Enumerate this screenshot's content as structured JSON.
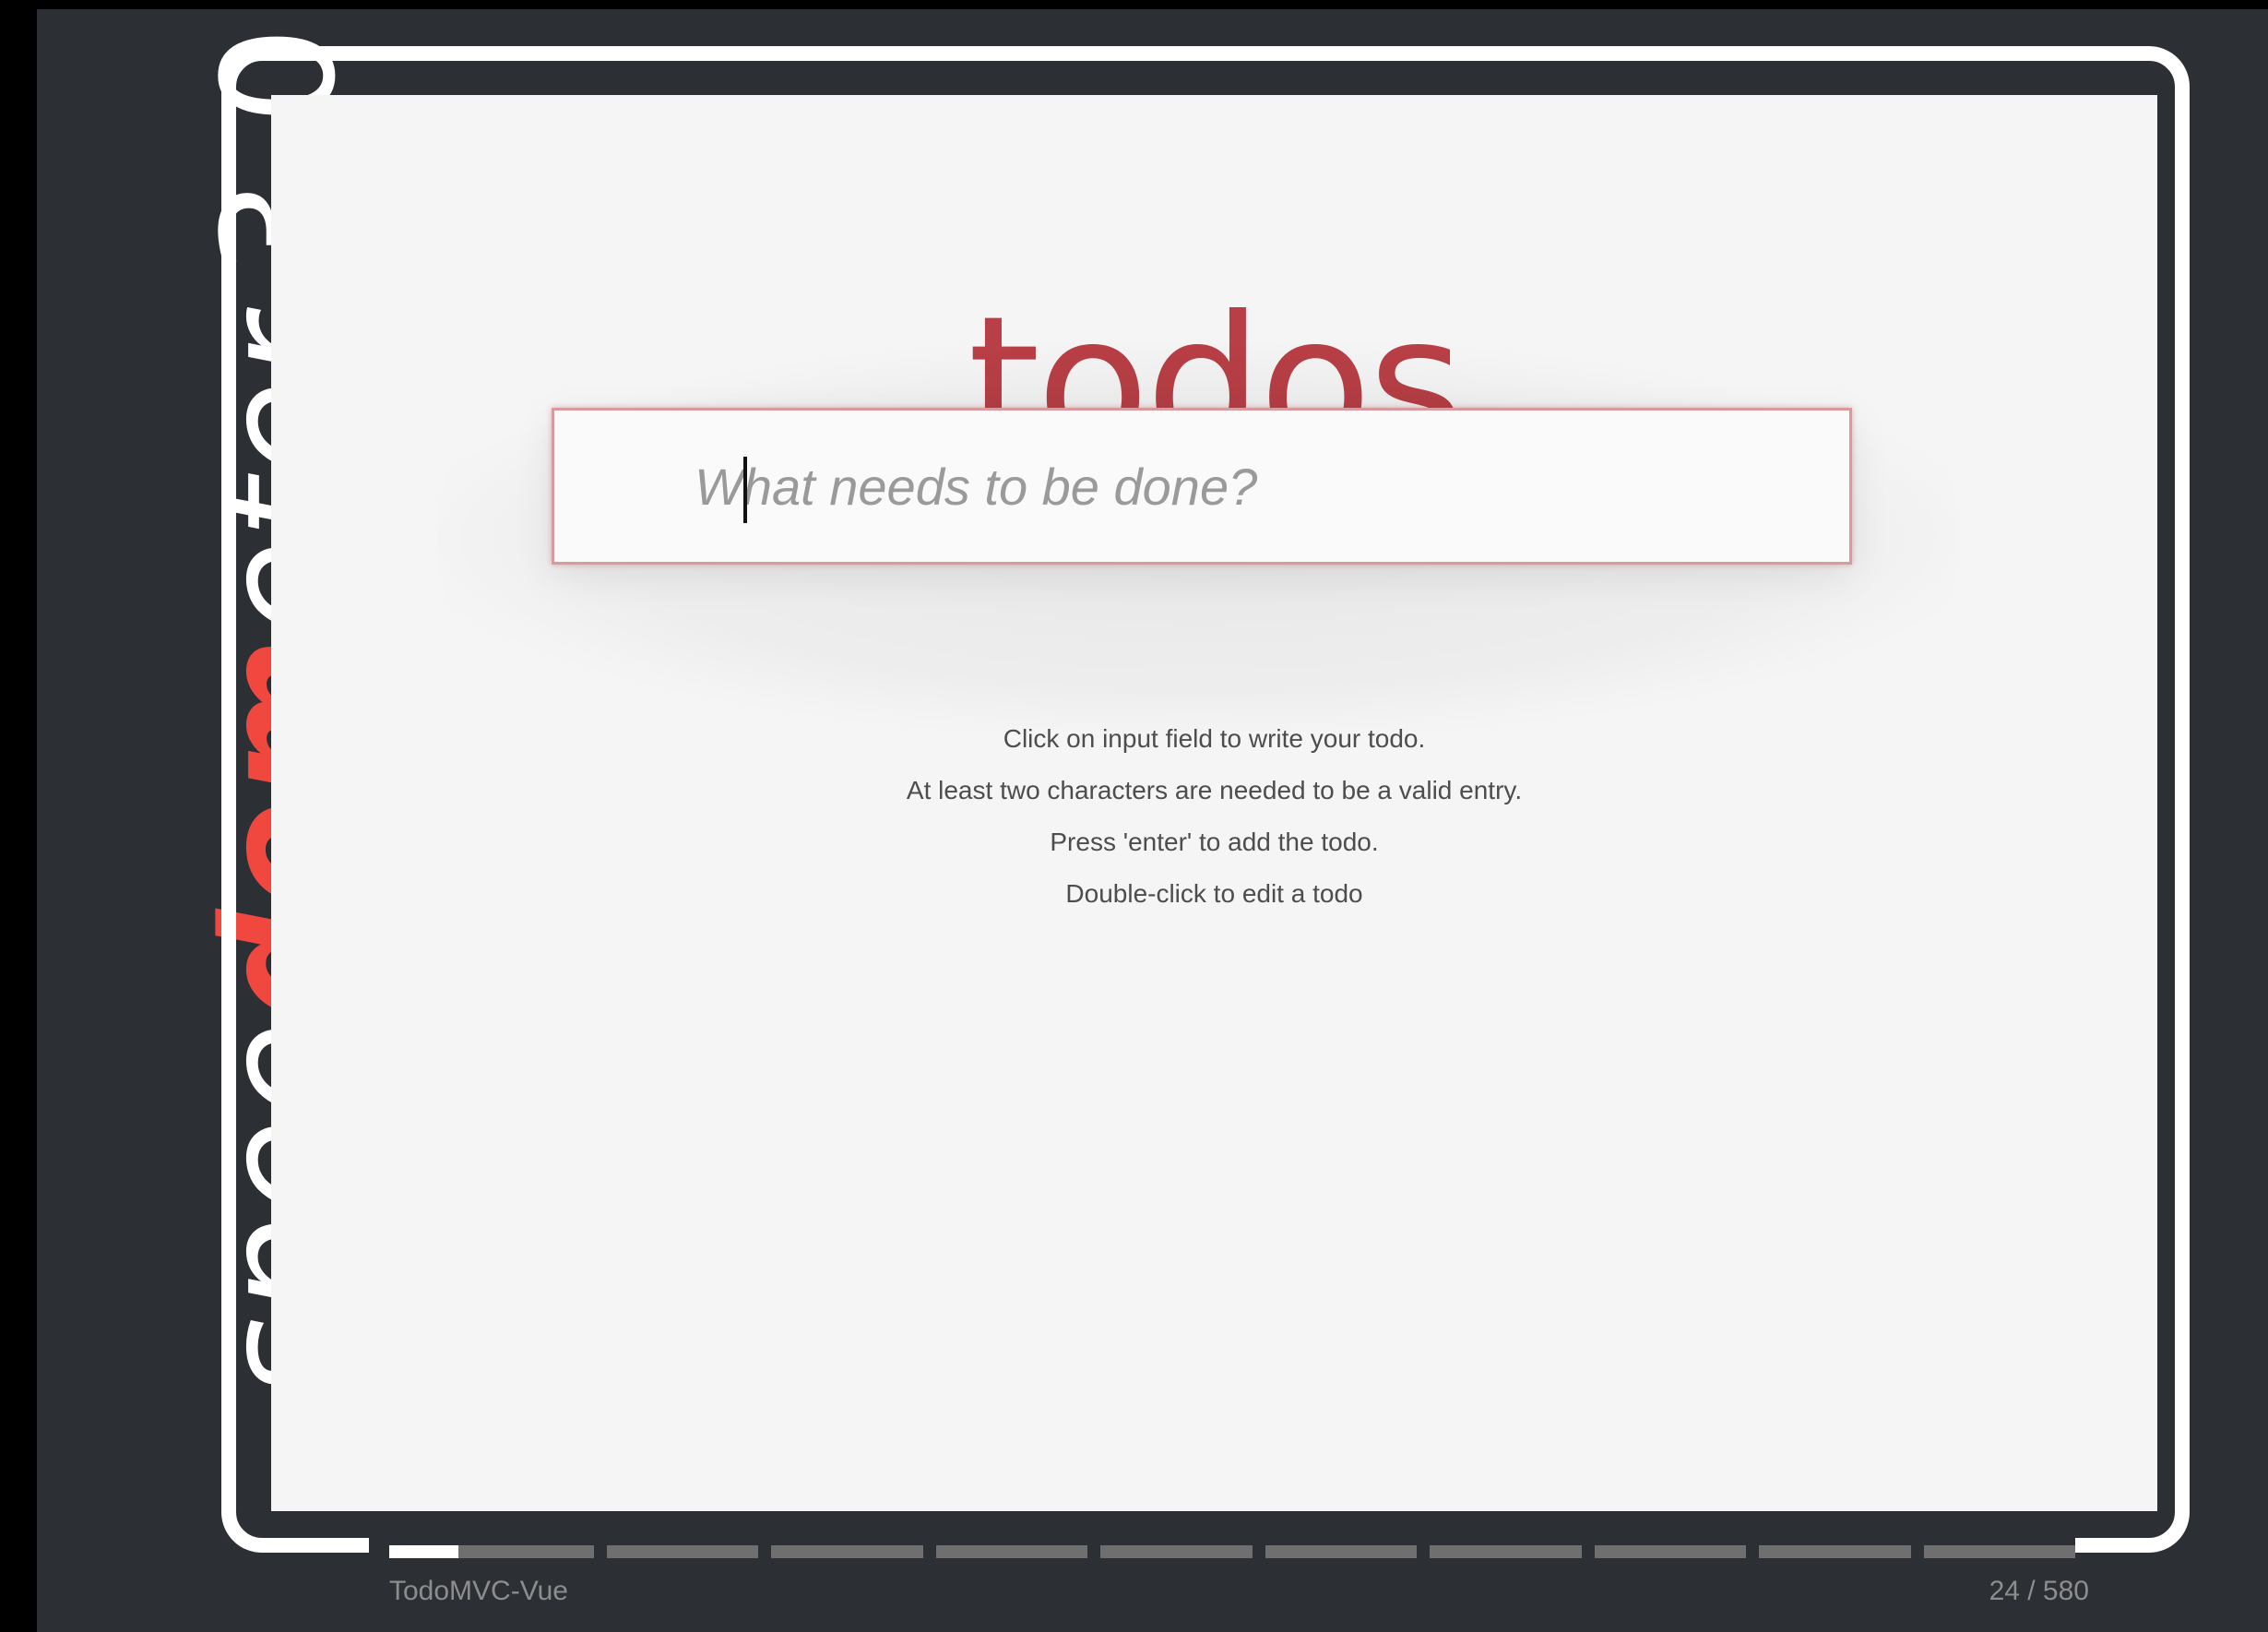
{
  "logo": {
    "prefix": "spee",
    "highlight_d": "d",
    "highlight_o": "o",
    "highlight_m": "m",
    "suffix": "eter",
    "version": "3.0",
    "highlight_color": "#f0483e",
    "icon": "speedometer-gauge-icon"
  },
  "app": {
    "title": "todos",
    "new_todo_placeholder": "What needs to be done?",
    "new_todo_value": "",
    "instructions": [
      "Click on input field to write your todo.",
      "At least two characters are needed to be a valid entry.",
      "Press 'enter' to add the todo.",
      "Double-click to edit a todo"
    ],
    "title_color": "#b83f45"
  },
  "footer": {
    "suite_name": "TodoMVC-Vue",
    "counter": "24 / 580",
    "progress_fraction": 0.041,
    "segment_count": 10
  }
}
